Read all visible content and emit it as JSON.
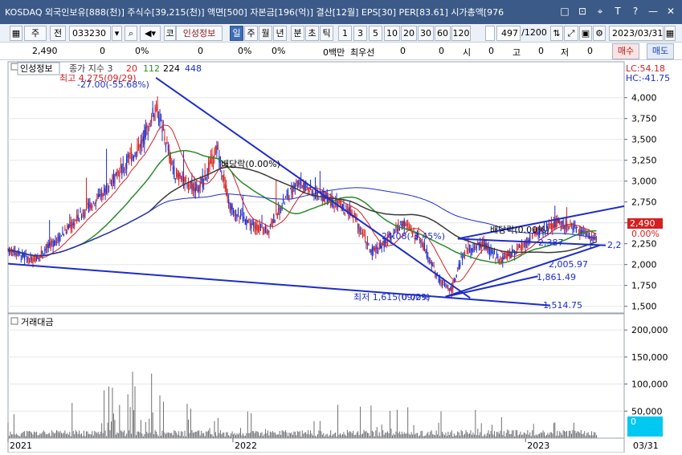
{
  "window": {
    "title": "KOSDAQ 외국인보유[888(천)] 주식수[39,215(천)] 액면[500] 자본금[196(억)] 결산[12월] EPS[30] PER[83.61] 시가총액[976",
    "buttons": [
      "□",
      "⊡",
      "⌖",
      "T",
      "?",
      "—",
      "✕"
    ]
  },
  "toolbar": {
    "mode_select": "주",
    "prefix": "전",
    "code": "033230",
    "name": "인성정보",
    "periods": [
      "일",
      "주",
      "월",
      "년",
      "분",
      "초",
      "틱"
    ],
    "selected_period": "일",
    "intervals": [
      "1",
      "3",
      "5",
      "10",
      "20",
      "30",
      "60",
      "120"
    ],
    "count": "497",
    "total": "/1200",
    "date": "2023/03/31"
  },
  "infobar": {
    "price": "2,490",
    "v1": "0",
    "v2": "0%",
    "v3": "0",
    "v4": "0%",
    "v5": "0%",
    "v6": "0백만",
    "preferred_label": "최우선",
    "v7": "0",
    "v8": "0",
    "open_label": "시",
    "open_val": "0",
    "high_label": "고",
    "high_val": "0",
    "low_label": "저",
    "low_val": "0",
    "buy_label": "매수",
    "sell_label": "매도"
  },
  "chart_data": [
    {
      "type": "candlestick",
      "title": "인성정보",
      "legend": [
        {
          "name": "종가 지수 3",
          "color": "#3a3a3a"
        },
        {
          "name": "20",
          "color": "#d42020"
        },
        {
          "name": "112",
          "color": "#2a8a2a"
        },
        {
          "name": "224",
          "color": "#000000"
        },
        {
          "name": "448",
          "color": "#1e2cc8"
        }
      ],
      "y_ticks": [
        1500,
        1750,
        2000,
        2250,
        2500,
        2750,
        3000,
        3250,
        3500,
        3750,
        4000
      ],
      "y_tick_labels": [
        "1,500",
        "1,750",
        "2,000",
        "2,250",
        "2,500",
        "2,750",
        "3,000",
        "3,250",
        "3,500",
        "3,750",
        "4,000"
      ],
      "ylim": [
        1420,
        4430
      ],
      "current_price": 2490,
      "current_price_label": "2,490",
      "current_pct_label": "0.00%",
      "lc_label": "LC:54.18",
      "hc_label": "HC:-41.75",
      "x_labels": [
        "2021",
        "2022",
        "2023"
      ],
      "date_label": "03/31",
      "annotations": {
        "max_label": "최고 4,275(09/29)",
        "max_pct": "-27.00(-55.68%)",
        "min_label": "최저 1,615(09/29)",
        "min_pct": "0.00%",
        "dividend1": "배당락(0.00%)",
        "dividend2": "배당락(0.00%)",
        "mid_label": "24.08(-3.45%)",
        "trend_end1": "2,2",
        "line_val1": "1,514.75",
        "line_val2": "1,861.49",
        "line_val3": "2,005.97",
        "line_val4": "2,387"
      },
      "trendlines": [
        {
          "from": [
            0.24,
            4240
          ],
          "to": [
            0.75,
            1600
          ]
        },
        {
          "from": [
            0.0,
            2010
          ],
          "to": [
            0.88,
            1510
          ]
        },
        {
          "from": [
            0.71,
            1615
          ],
          "to": [
            0.96,
            2230
          ]
        },
        {
          "from": [
            0.71,
            1615
          ],
          "to": [
            0.86,
            1860
          ]
        },
        {
          "from": [
            0.73,
            2310
          ],
          "to": [
            1.0,
            2700
          ]
        },
        {
          "from": [
            0.73,
            2310
          ],
          "to": [
            0.97,
            2230
          ]
        }
      ]
    },
    {
      "type": "bar",
      "title": "거래대금",
      "y_ticks": [
        50000,
        100000,
        150000,
        200000
      ],
      "y_tick_labels": [
        "50,000",
        "100,000",
        "150,000",
        "200,000"
      ],
      "ylim": [
        0,
        230000
      ],
      "current_label": "0"
    }
  ]
}
